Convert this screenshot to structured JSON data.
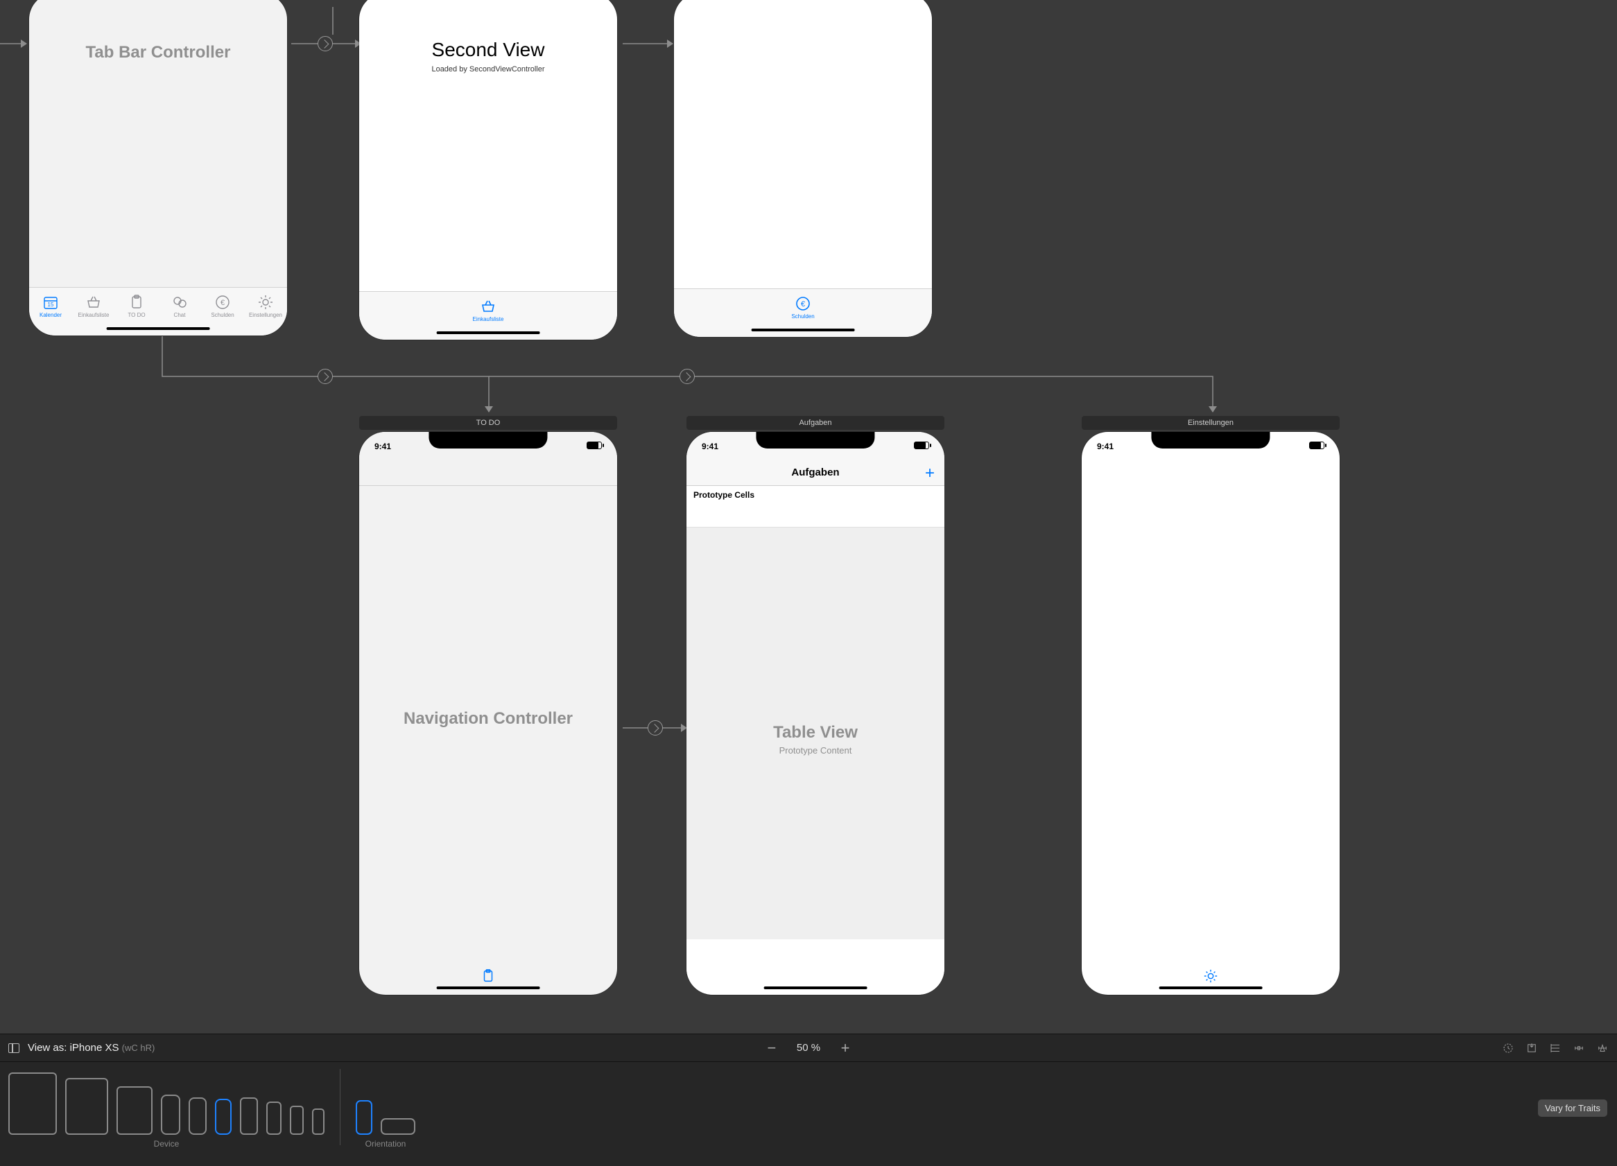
{
  "status_time": "9:41",
  "scenes": {
    "tabbar_ctrl": {
      "title": "Tab Bar Controller",
      "tabs": [
        "Kalender",
        "Einkaufsliste",
        "TO DO",
        "Chat",
        "Schulden",
        "Einstellungen"
      ]
    },
    "second_view": {
      "title": "Second View",
      "subtitle": "Loaded by SecondViewController",
      "tab_label": "Einkaufsliste"
    },
    "schulden_view": {
      "tab_label": "Schulden"
    },
    "nav_ctrl": {
      "header": "TO DO",
      "title": "Navigation Controller"
    },
    "aufgaben": {
      "header": "Aufgaben",
      "nav_title": "Aufgaben",
      "proto_header": "Prototype Cells",
      "table_title": "Table View",
      "table_sub": "Prototype Content"
    },
    "einstellungen": {
      "header": "Einstellungen"
    }
  },
  "footer": {
    "view_as_prefix": "View as: ",
    "view_as_device": "iPhone XS",
    "traits": "(wC hR)",
    "zoom": "50 %",
    "device_label": "Device",
    "orientation_label": "Orientation",
    "vary": "Vary for Traits"
  }
}
